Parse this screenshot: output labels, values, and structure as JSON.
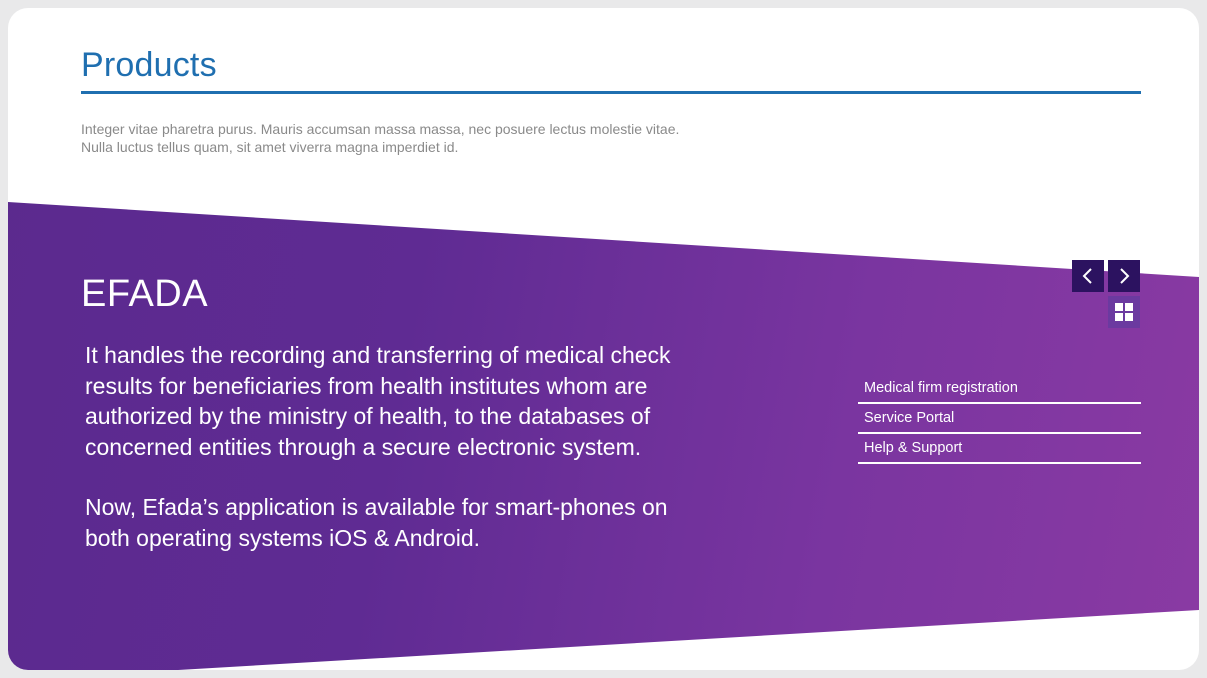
{
  "header": {
    "title": "Products",
    "intro_lines": [
      "Integer vitae pharetra purus. Mauris accumsan massa massa, nec posuere lectus molestie vitae.",
      "Nulla luctus tellus quam, sit amet viverra magna imperdiet id."
    ],
    "title_color": "#1f6fb0"
  },
  "feature": {
    "name": "EFADA",
    "paragraphs": [
      "It handles the recording and transferring of medical check results for beneficiaries from health institutes whom are authorized by the ministry of health, to the databases of concerned entities through a secure electronic system.",
      "Now, Efada’s application is available for smart-phones on both operating systems iOS & Android."
    ],
    "band_colors": [
      "#5b2a8e",
      "#8a3aa3"
    ]
  },
  "controls": {
    "prev_icon": "chevron-left-icon",
    "next_icon": "chevron-right-icon",
    "grid_icon": "grid-icon"
  },
  "links": [
    {
      "label": "Medical firm registration"
    },
    {
      "label": "Service Portal"
    },
    {
      "label": "Help & Support"
    }
  ]
}
